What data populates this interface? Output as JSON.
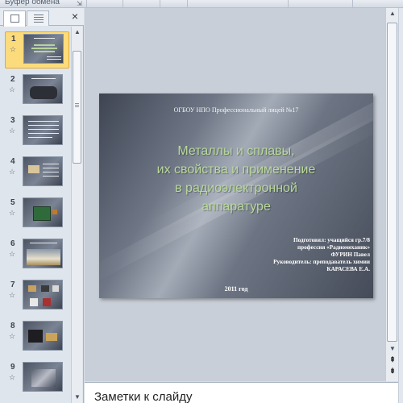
{
  "ribbon": {
    "group_label": "Буфер обмена",
    "launcher_icon": "dialog-launcher-icon"
  },
  "panel": {
    "tabs": [
      {
        "name": "slides",
        "icon": "slides-tab-icon"
      },
      {
        "name": "outline",
        "icon": "outline-tab-icon"
      }
    ],
    "close_label": "×"
  },
  "thumbnails": [
    {
      "number": "1",
      "star": "☆"
    },
    {
      "number": "2",
      "star": "☆"
    },
    {
      "number": "3",
      "star": "☆"
    },
    {
      "number": "4",
      "star": "☆"
    },
    {
      "number": "5",
      "star": "☆"
    },
    {
      "number": "6",
      "star": "☆"
    },
    {
      "number": "7",
      "star": "☆"
    },
    {
      "number": "8",
      "star": "☆"
    },
    {
      "number": "9",
      "star": "☆"
    }
  ],
  "selected_slide": 1,
  "slide": {
    "org": "ОГБОУ НПО Профессиональный  лицей №17",
    "title_lines": [
      "Металлы  и сплавы,",
      "их свойства и применение",
      "в радиоэлектронной",
      "аппаратуре"
    ],
    "credits": [
      "Подготовил: учащийся гр.7/8",
      "профессия «Радиомеханик»",
      "ФУРИН Павел",
      "Руководитель: преподаватель химии",
      "КАРАСЕВА Е.А."
    ],
    "year": "2011 год"
  },
  "scroll": {
    "up": "▲",
    "down": "▼",
    "prev_slide": "⇞",
    "next_slide": "⇟"
  },
  "notes": {
    "placeholder": "Заметки к слайду"
  },
  "colors": {
    "selection": "#fbdb7c",
    "title_green": "#b9d99a"
  }
}
